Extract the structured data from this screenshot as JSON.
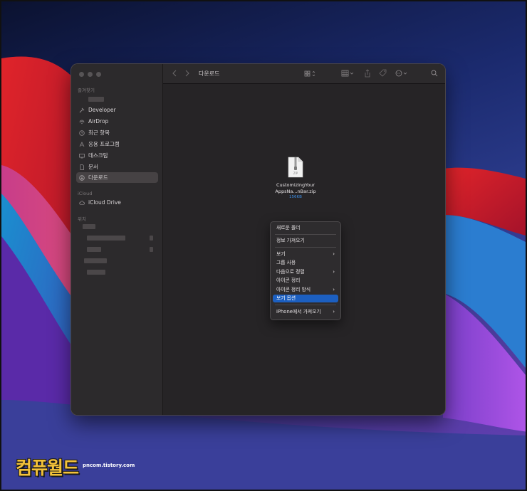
{
  "finder": {
    "title": "다운로드",
    "sidebar": {
      "favorites_label": "즐겨찾기",
      "items": [
        {
          "label": "Developer",
          "icon": "hammer-icon"
        },
        {
          "label": "AirDrop",
          "icon": "airdrop-icon"
        },
        {
          "label": "최근 항목",
          "icon": "clock-icon"
        },
        {
          "label": "응용 프로그램",
          "icon": "apps-icon"
        },
        {
          "label": "데스크탑",
          "icon": "desktop-icon"
        },
        {
          "label": "문서",
          "icon": "document-icon"
        },
        {
          "label": "다운로드",
          "icon": "download-icon",
          "selected": true
        }
      ],
      "icloud_label": "iCloud",
      "icloud_items": [
        {
          "label": "iCloud Drive",
          "icon": "cloud-icon"
        }
      ],
      "locations_label": "위치"
    },
    "file": {
      "name_line1": "CustomizingYour",
      "name_line2": "AppsNa...nBar.zip",
      "size": "156KB",
      "type_badge": "ZIP"
    },
    "context_menu": {
      "items": [
        {
          "label": "새로운 폴더"
        },
        {
          "label": "정보 가져오기"
        },
        {
          "label": "보기",
          "submenu": true
        },
        {
          "label": "그룹 사용"
        },
        {
          "label": "다음으로 정렬",
          "submenu": true
        },
        {
          "label": "아이콘 정리"
        },
        {
          "label": "아이콘 정리 방식",
          "submenu": true
        },
        {
          "label": "보기 옵션",
          "highlighted": true
        },
        {
          "label": "iPhone에서 가져오기",
          "submenu": true
        }
      ]
    }
  },
  "watermark": {
    "brand": "컴퓨월드",
    "url": "pncom.tistory.com"
  },
  "colors": {
    "accent": "#1c5fc0",
    "file_size": "#3c8ee6",
    "brand": "#f3c23a"
  }
}
